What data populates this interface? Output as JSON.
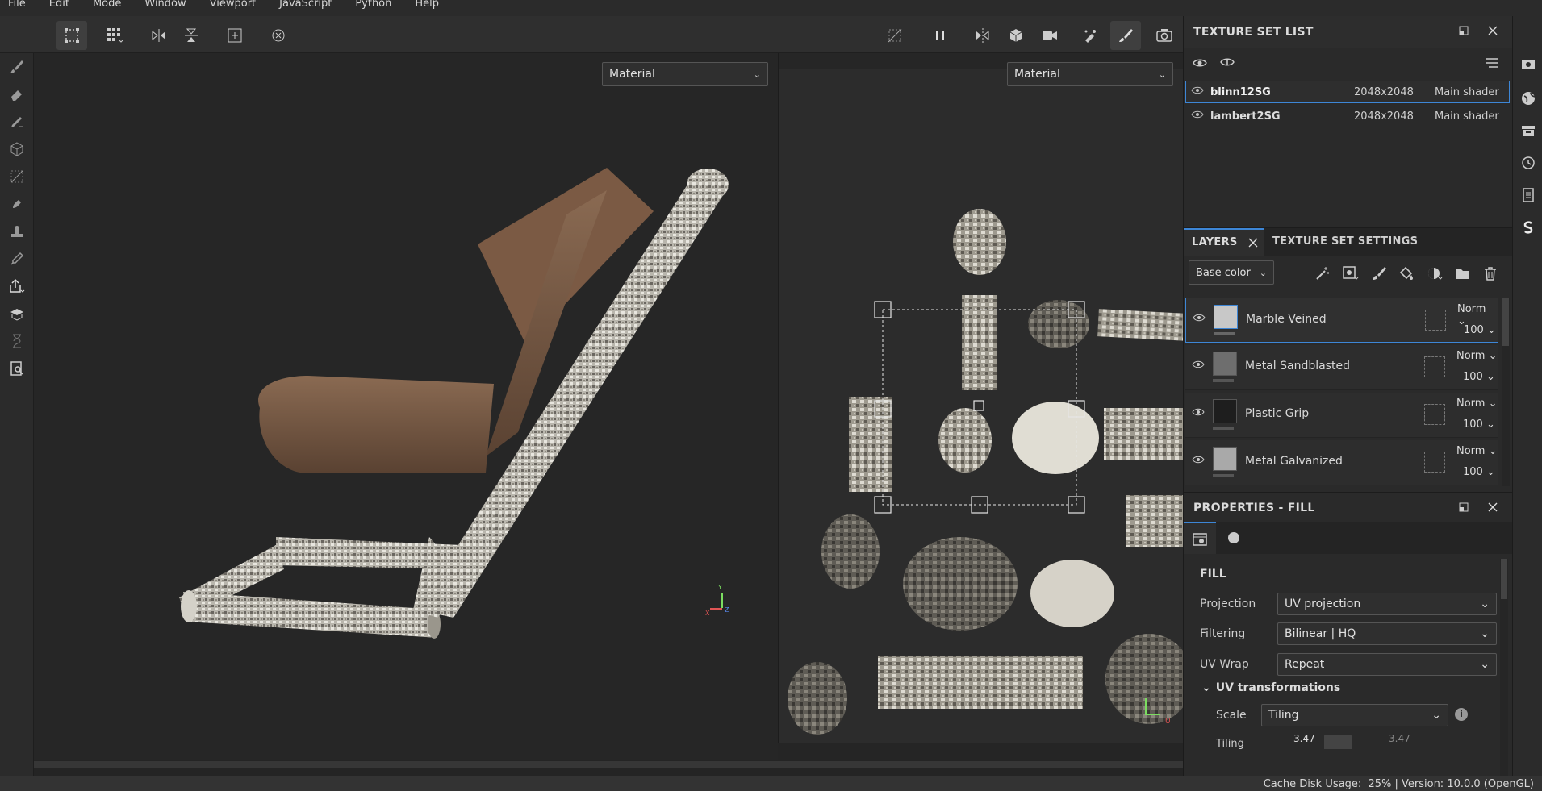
{
  "menu": [
    "File",
    "Edit",
    "Mode",
    "Window",
    "Viewport",
    "JavaScript",
    "Python",
    "Help"
  ],
  "viewport3d": {
    "dropdown_value": "Material",
    "axis_labels": {
      "x": "X",
      "y": "Y",
      "z": "Z"
    }
  },
  "viewport2d": {
    "dropdown_value": "Material",
    "axis_labels": {
      "u": "U"
    }
  },
  "texture_set_list": {
    "title": "TEXTURE SET LIST",
    "rows": [
      {
        "name": "blinn12SG",
        "resolution": "2048x2048",
        "shader": "Main shader",
        "selected": true
      },
      {
        "name": "lambert2SG",
        "resolution": "2048x2048",
        "shader": "Main shader",
        "selected": false
      }
    ]
  },
  "layers_panel": {
    "tab_layers": "LAYERS",
    "tab_settings": "TEXTURE SET SETTINGS",
    "channel": "Base color",
    "layers": [
      {
        "name": "Marble Veined",
        "blend": "Norm",
        "opacity": "100",
        "thumb": "#c8c8c8",
        "selected": true
      },
      {
        "name": "Metal Sandblasted",
        "blend": "Norm",
        "opacity": "100",
        "thumb": "#6e6e6e",
        "selected": false
      },
      {
        "name": "Plastic Grip",
        "blend": "Norm",
        "opacity": "100",
        "thumb": "#1e1e1e",
        "selected": false
      },
      {
        "name": "Metal Galvanized",
        "blend": "Norm",
        "opacity": "100",
        "thumb": "#a9a9a9",
        "selected": false
      }
    ]
  },
  "properties": {
    "title": "PROPERTIES - FILL",
    "section": "FILL",
    "projection_label": "Projection",
    "projection_value": "UV projection",
    "filtering_label": "Filtering",
    "filtering_value": "Bilinear | HQ",
    "uvwrap_label": "UV Wrap",
    "uvwrap_value": "Repeat",
    "uv_transform_header": "UV transformations",
    "scale_label": "Scale",
    "scale_value": "Tiling",
    "tiling_label": "Tiling",
    "tiling_value_left": "3.47",
    "tiling_value_right": "3.47"
  },
  "status": {
    "text": "Cache Disk Usage:  25% | Version: 10.0.0 (OpenGL)"
  },
  "colors": {
    "accent": "#3d86d6",
    "panel": "#2a2a2a",
    "background": "#262626"
  }
}
